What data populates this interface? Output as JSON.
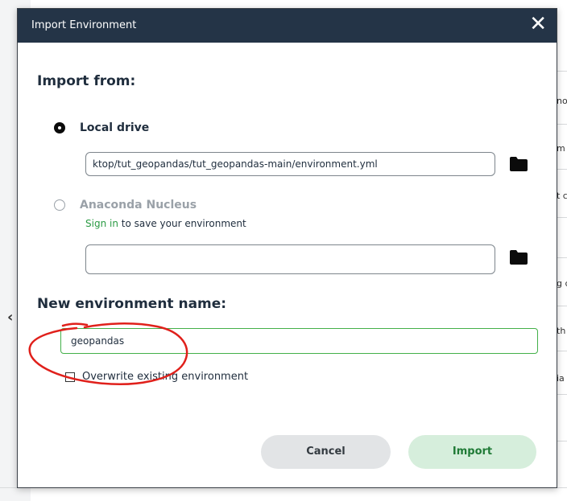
{
  "background": {
    "row_fragments": [
      "no",
      "m",
      "t c",
      "g c",
      "th",
      "ia"
    ]
  },
  "dialog": {
    "title": "Import Environment",
    "close_glyph": "✕",
    "import_from_label": "Import from:",
    "local_drive": {
      "label": "Local drive",
      "selected": true,
      "path_value": "ktop/tut_geopandas/tut_geopandas-main/environment.yml"
    },
    "anaconda_nucleus": {
      "label": "Anaconda Nucleus",
      "selected": false,
      "signin_link": "Sign in",
      "signin_suffix": " to save your environment",
      "path_value": ""
    },
    "new_env_label": "New environment name:",
    "env_name_value": "geopandas",
    "overwrite_label": "Overwrite existing environment",
    "overwrite_checked": false,
    "cancel_label": "Cancel",
    "import_label": "Import"
  },
  "icons": {
    "folder": "folder-icon",
    "close": "close-icon",
    "collapse": "chevron-left-icon"
  },
  "colors": {
    "header_bg": "#243447",
    "accent_green": "#43b049",
    "link_green": "#2a9a43",
    "annotation_red": "#e0201b"
  }
}
